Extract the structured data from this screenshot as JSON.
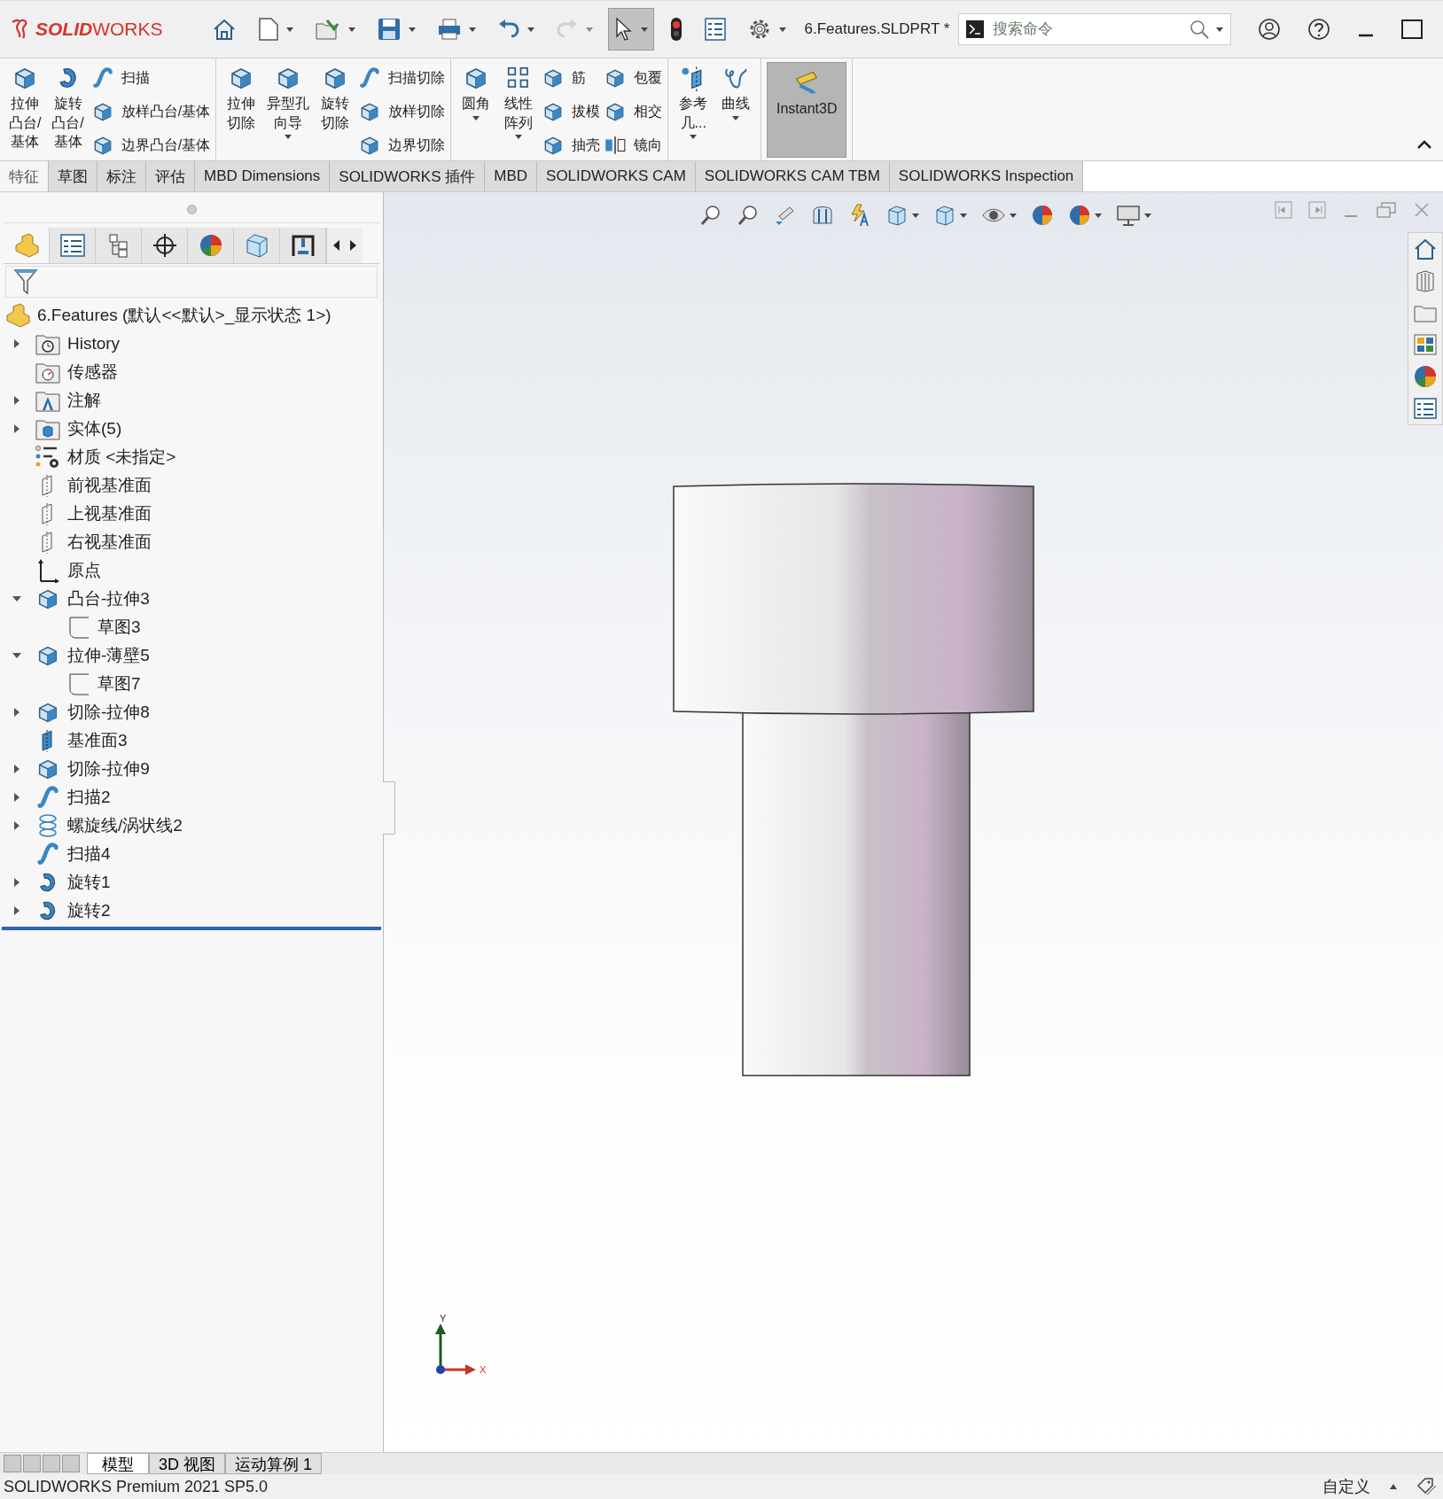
{
  "app_bar": {
    "logo": "**SOLID**WORKS",
    "document_title": "6.Features.SLDPRT *",
    "search": {
      "placeholder": "搜索命令"
    },
    "tools": [
      {
        "kind": "home",
        "dropdown": false,
        "selected": false,
        "disabled": false
      },
      {
        "kind": "new",
        "dropdown": true,
        "selected": false,
        "disabled": false
      },
      {
        "kind": "open",
        "dropdown": true,
        "selected": false,
        "disabled": false
      },
      {
        "kind": "save",
        "dropdown": true,
        "selected": false,
        "disabled": false
      },
      {
        "kind": "print",
        "dropdown": true,
        "selected": false,
        "disabled": false
      },
      {
        "kind": "undo",
        "dropdown": true,
        "selected": false,
        "disabled": false
      },
      {
        "kind": "redo",
        "dropdown": true,
        "selected": false,
        "disabled": true
      },
      {
        "kind": "select",
        "dropdown": true,
        "selected": true,
        "disabled": false
      },
      {
        "kind": "rebuild",
        "dropdown": false,
        "selected": false,
        "disabled": false
      },
      {
        "kind": "file-properties",
        "dropdown": false,
        "selected": false,
        "disabled": false
      },
      {
        "kind": "options",
        "dropdown": true,
        "selected": false,
        "disabled": false
      }
    ]
  },
  "ribbon": {
    "groups": [
      {
        "items": [
          {
            "kind": "large",
            "label": "拉伸凸台/基体",
            "dropdown": false,
            "selected": false
          },
          {
            "kind": "large",
            "label": "旋转凸台/基体",
            "dropdown": false,
            "selected": false
          },
          {
            "kind": "stack",
            "items": [
              {
                "label": "扫描"
              },
              {
                "label": "放样凸台/基体"
              },
              {
                "label": "边界凸台/基体"
              }
            ]
          }
        ]
      },
      {
        "items": [
          {
            "kind": "large",
            "label": "拉伸切除",
            "dropdown": false,
            "selected": false
          },
          {
            "kind": "large",
            "label": "异型孔向导",
            "dropdown": true,
            "selected": false
          },
          {
            "kind": "large",
            "label": "旋转切除",
            "dropdown": false,
            "selected": false
          },
          {
            "kind": "stack",
            "items": [
              {
                "label": "扫描切除"
              },
              {
                "label": "放样切除"
              },
              {
                "label": "边界切除"
              }
            ]
          }
        ]
      },
      {
        "items": [
          {
            "kind": "large",
            "label": "圆角",
            "dropdown": true,
            "selected": false
          },
          {
            "kind": "large",
            "label": "线性阵列",
            "dropdown": true,
            "selected": false
          },
          {
            "kind": "stack",
            "items": [
              {
                "label": "筋"
              },
              {
                "label": "拔模"
              },
              {
                "label": "抽壳"
              }
            ]
          },
          {
            "kind": "stack",
            "items": [
              {
                "label": "包覆"
              },
              {
                "label": "相交"
              },
              {
                "label": "镜向"
              }
            ]
          }
        ]
      },
      {
        "items": [
          {
            "kind": "large",
            "label": "参考几...",
            "dropdown": true,
            "selected": false
          },
          {
            "kind": "large",
            "label": "曲线",
            "dropdown": true,
            "selected": false
          }
        ]
      },
      {
        "items": [
          {
            "kind": "large",
            "label": "Instant3D",
            "dropdown": false,
            "selected": true
          }
        ]
      }
    ]
  },
  "tabs": [
    {
      "label": "特征",
      "selected": true
    },
    {
      "label": "草图",
      "selected": false
    },
    {
      "label": "标注",
      "selected": false
    },
    {
      "label": "评估",
      "selected": false
    },
    {
      "label": "MBD Dimensions",
      "selected": false
    },
    {
      "label": "SOLIDWORKS 插件",
      "selected": false
    },
    {
      "label": "MBD",
      "selected": false
    },
    {
      "label": "SOLIDWORKS CAM",
      "selected": false
    },
    {
      "label": "SOLIDWORKS CAM TBM",
      "selected": false
    },
    {
      "label": "SOLIDWORKS Inspection",
      "selected": false
    }
  ],
  "panel_tabs": [
    {
      "kind": "part",
      "selected": true
    },
    {
      "kind": "list",
      "selected": false
    },
    {
      "kind": "config",
      "selected": false
    },
    {
      "kind": "target",
      "selected": false
    },
    {
      "kind": "sphere",
      "selected": false
    },
    {
      "kind": "cube",
      "selected": false
    },
    {
      "kind": "cam",
      "selected": false
    }
  ],
  "tree": {
    "root": {
      "label": "6.Features  (默认<<默认>_显示状态 1>)"
    },
    "items": [
      {
        "kind": "history",
        "label": "History",
        "expanded": false
      },
      {
        "kind": "sensor",
        "label": "传感器"
      },
      {
        "kind": "annotation",
        "label": "注解",
        "expanded": false
      },
      {
        "kind": "solid",
        "label": "实体(5)",
        "expanded": false
      },
      {
        "kind": "material",
        "label": "材质 <未指定>"
      },
      {
        "kind": "plane",
        "label": "前视基准面"
      },
      {
        "kind": "plane",
        "label": "上视基准面"
      },
      {
        "kind": "plane",
        "label": "右视基准面"
      },
      {
        "kind": "origin",
        "label": "原点"
      },
      {
        "kind": "extrude",
        "label": "凸台-拉伸3",
        "expanded": true,
        "children": [
          {
            "kind": "sketch",
            "label": "草图3"
          }
        ]
      },
      {
        "kind": "extrude",
        "label": "拉伸-薄壁5",
        "expanded": true,
        "children": [
          {
            "kind": "sketch",
            "label": "草图7"
          }
        ]
      },
      {
        "kind": "cut",
        "label": "切除-拉伸8",
        "expanded": false
      },
      {
        "kind": "plane-solid",
        "label": "基准面3"
      },
      {
        "kind": "cut",
        "label": "切除-拉伸9",
        "expanded": false
      },
      {
        "kind": "sweep",
        "label": "扫描2",
        "expanded": false
      },
      {
        "kind": "helix",
        "label": "螺旋线/涡状线2",
        "expanded": false
      },
      {
        "kind": "sweep",
        "label": "扫描4"
      },
      {
        "kind": "revolve",
        "label": "旋转1",
        "expanded": false
      },
      {
        "kind": "revolve",
        "label": "旋转2",
        "expanded": false
      }
    ]
  },
  "viewport": {
    "view_tools": [
      {
        "kind": "zoom-fit",
        "dropdown": false
      },
      {
        "kind": "zoom-area",
        "dropdown": false
      },
      {
        "kind": "previous",
        "dropdown": false
      },
      {
        "kind": "section",
        "dropdown": false
      },
      {
        "kind": "annotation",
        "dropdown": false
      },
      {
        "kind": "orientation",
        "dropdown": true
      },
      {
        "kind": "display",
        "dropdown": true
      },
      {
        "kind": "eye",
        "dropdown": true
      },
      {
        "kind": "appearance",
        "dropdown": false
      },
      {
        "kind": "scene",
        "dropdown": true
      },
      {
        "kind": "monitor",
        "dropdown": true
      }
    ],
    "triad": {
      "y_label": "Y",
      "x_label": "X"
    }
  },
  "bottom_tabs": [
    {
      "label": "模型",
      "selected": true
    },
    {
      "label": "3D 视图",
      "selected": false
    },
    {
      "label": "运动算例 1",
      "selected": false
    }
  ],
  "status_bar": {
    "product": "SOLIDWORKS Premium 2021 SP5.0",
    "units": "自定义"
  }
}
